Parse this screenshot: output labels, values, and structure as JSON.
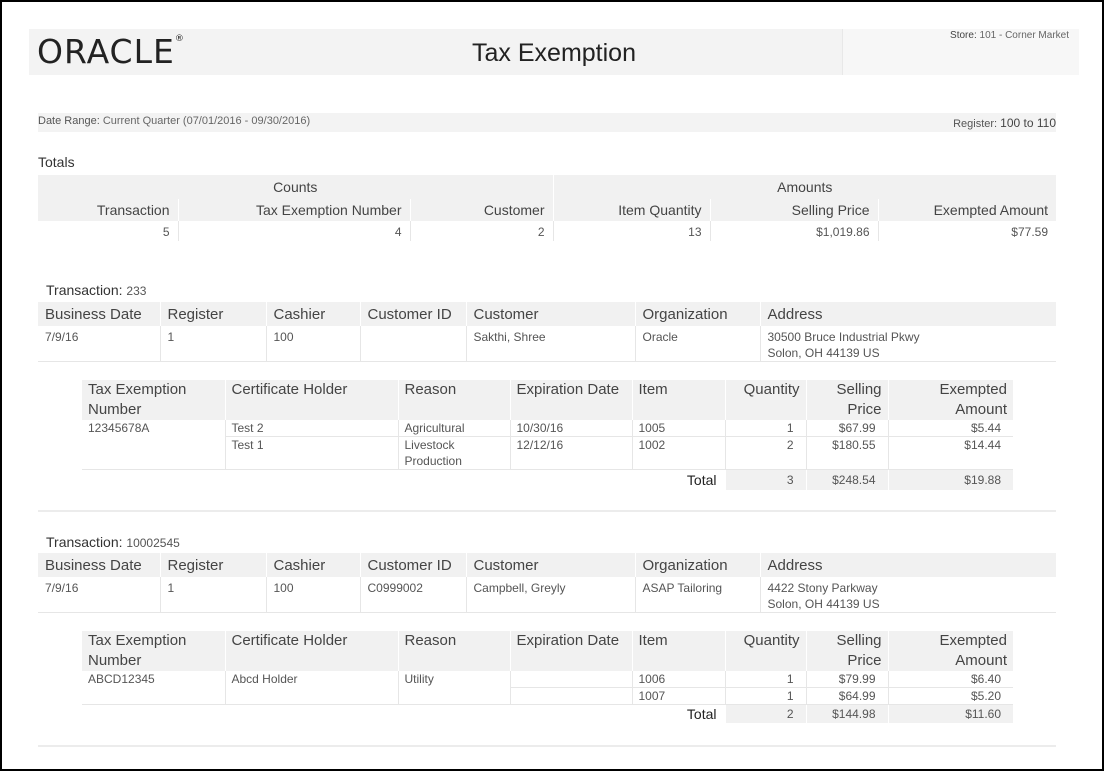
{
  "header": {
    "logo": "ORACLE",
    "title": "Tax Exemption",
    "store_label": "Store:",
    "store_value": "101 - Corner Market"
  },
  "params": {
    "date_range_label": "Date Range:",
    "date_range_value": "Current Quarter (07/01/2016 - 09/30/2016)",
    "register_label": "Register:",
    "register_value": "100 to 110"
  },
  "totals": {
    "title": "Totals",
    "groups": [
      "Counts",
      "Amounts"
    ],
    "columns": [
      "Transaction",
      "Tax Exemption Number",
      "Customer",
      "Item Quantity",
      "Selling Price",
      "Exempted Amount"
    ],
    "values": [
      "5",
      "4",
      "2",
      "13",
      "$1,019.86",
      "$77.59"
    ]
  },
  "txn_columns": [
    "Business Date",
    "Register",
    "Cashier",
    "Customer ID",
    "Customer",
    "Organization",
    "Address"
  ],
  "det_columns": [
    "Tax Exemption Number",
    "Certificate Holder",
    "Reason",
    "Expiration Date",
    "Item",
    "Quantity",
    "Selling Price",
    "Exempted Amount"
  ],
  "total_label": "Total",
  "transactions": [
    {
      "label": "Transaction:",
      "number": "233",
      "business_date": "7/9/16",
      "register": "1",
      "cashier": "100",
      "customer_id": "",
      "customer": "Sakthi, Shree",
      "organization": "Oracle",
      "address_line1": "30500 Bruce Industrial Pkwy",
      "address_line2": "Solon, OH 44139 US",
      "exemption_number": "12345678A",
      "lines": [
        {
          "holder": "Test 2",
          "reason": "Agricultural",
          "expiration": "10/30/16",
          "item": "1005",
          "quantity": "1",
          "price": "$67.99",
          "exempted": "$5.44"
        },
        {
          "holder": "Test 1",
          "reason": "Livestock Production",
          "expiration": "12/12/16",
          "item": "1002",
          "quantity": "2",
          "price": "$180.55",
          "exempted": "$14.44"
        }
      ],
      "total_quantity": "3",
      "total_price": "$248.54",
      "total_exempted": "$19.88"
    },
    {
      "label": "Transaction:",
      "number": "10002545",
      "business_date": "7/9/16",
      "register": "1",
      "cashier": "100",
      "customer_id": "C0999002",
      "customer": "Campbell, Greyly",
      "organization": "ASAP Tailoring",
      "address_line1": "4422 Stony Parkway",
      "address_line2": "Solon, OH 44139 US",
      "exemption_number": "ABCD12345",
      "lines": [
        {
          "holder": "Abcd Holder",
          "reason": "Utility",
          "expiration": "",
          "item": "1006",
          "quantity": "1",
          "price": "$79.99",
          "exempted": "$6.40"
        },
        {
          "holder": "",
          "reason": "",
          "expiration": "",
          "item": "1007",
          "quantity": "1",
          "price": "$64.99",
          "exempted": "$5.20"
        }
      ],
      "total_quantity": "2",
      "total_price": "$144.98",
      "total_exempted": "$11.60"
    }
  ]
}
